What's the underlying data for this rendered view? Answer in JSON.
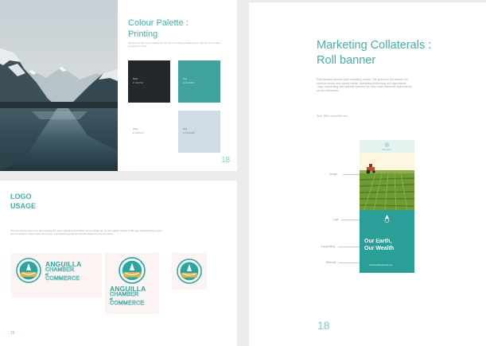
{
  "palette_page": {
    "title_line1": "Colour Palette :",
    "title_line2": "Printing",
    "description": "Always use the colour palette for your print marketing collaterals so that the brand stays consistent in print.",
    "swatches": [
      {
        "name": "Black",
        "code": "# 24272C",
        "color": "#24272c"
      },
      {
        "name": "Teal",
        "code": "# 41A39D",
        "color": "#41a39d"
      },
      {
        "name": "White",
        "code": "# FFFFFF",
        "color": "#ffffff"
      },
      {
        "name": "Blue",
        "code": "# CFDCE6",
        "color": "#cfdce6"
      }
    ],
    "page_number": "18",
    "photo_icon": "mountain-lake-photo"
  },
  "logo_page": {
    "title_line1": "LOGO",
    "title_line2": "USAGE",
    "description": "The two version logo is for all 3 meeting for most marketing and Media. Great. White are on also select colored of the logo without losing impact and recognition. These ratios are shown. The following guide are should always be use the same.",
    "logo": {
      "name": "ANGUILLA",
      "chamber": "CHAMBER",
      "of": "of",
      "commerce": "COMMERCE",
      "emblem_icon": "anguilla-emblem-icon"
    },
    "page_number": "16"
  },
  "banner_page": {
    "title_line1": "Marketing Collaterals :",
    "title_line2": "Roll banner",
    "description": "Roll banners become print marketing media. The ground in the banner roll must be simple and clearly visible. Marketing technology and agricultural. Logo, copywriting, and website become the other main elements that must be on the roll banner.",
    "size": "Size: 850 x mm2000 mm",
    "callouts": {
      "image": "Image",
      "logo": "Logo",
      "copywriting": "Copywriting",
      "website": "Website"
    },
    "mock": {
      "slogan_line1": "Our Earth,",
      "slogan_line2": "Our Wealth",
      "website": "www.anguillachamber.com",
      "mini_logo_text": "ANGUILLA",
      "tractor_icon": "tractor-icon"
    },
    "page_number": "18"
  },
  "colors": {
    "accent": "#41b1a6",
    "teal_dark": "#2a9f97",
    "dark": "#24272c",
    "light_blue": "#cfdce6"
  }
}
